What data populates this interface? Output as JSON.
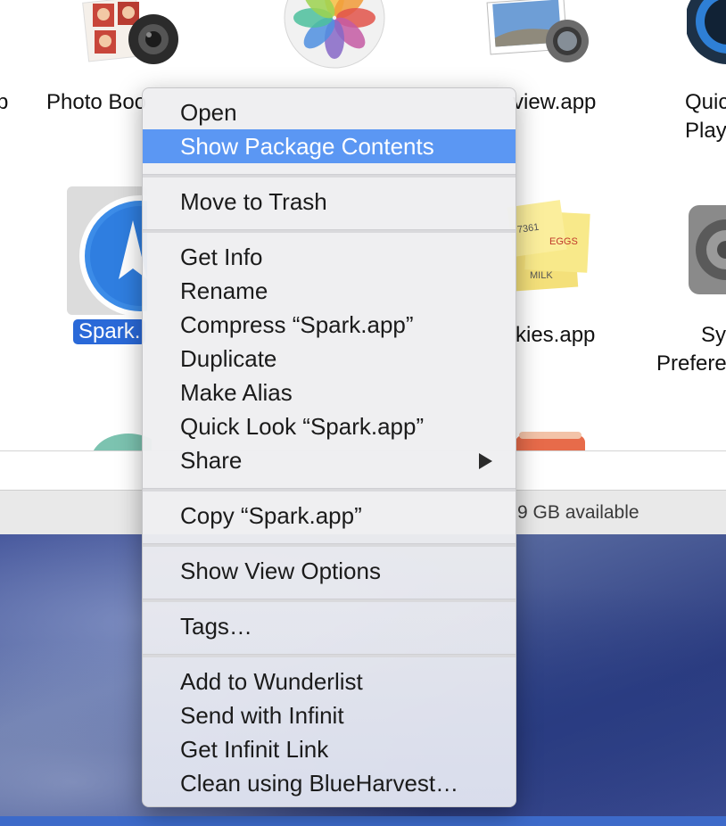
{
  "finder": {
    "apps": [
      {
        "label": "p"
      },
      {
        "label": "Photo Boo"
      },
      {
        "label": "view.app"
      },
      {
        "label": "Quic"
      },
      {
        "label": "Play"
      },
      {
        "label": "Spark."
      },
      {
        "label": "kies.app"
      },
      {
        "label": "Sy"
      },
      {
        "label": "Prefere"
      }
    ],
    "status": {
      "available": "9 GB available"
    }
  },
  "context_menu": {
    "items": [
      {
        "label": "Open"
      },
      {
        "label": "Show Package Contents"
      },
      {
        "label": "Move to Trash"
      },
      {
        "label": "Get Info"
      },
      {
        "label": "Rename"
      },
      {
        "label": "Compress “Spark.app”"
      },
      {
        "label": "Duplicate"
      },
      {
        "label": "Make Alias"
      },
      {
        "label": "Quick Look “Spark.app”"
      },
      {
        "label": "Share"
      },
      {
        "label": "Copy “Spark.app”"
      },
      {
        "label": "Show View Options"
      },
      {
        "label": "Tags…"
      },
      {
        "label": "Add to Wunderlist"
      },
      {
        "label": "Send with Infinit"
      },
      {
        "label": "Get Infinit Link"
      },
      {
        "label": "Clean using BlueHarvest…"
      }
    ],
    "highlight_color": "#5b97f3"
  },
  "sticky_note": {
    "text_1": "7361",
    "text_2": "EGGS",
    "text_3": "MILK"
  }
}
